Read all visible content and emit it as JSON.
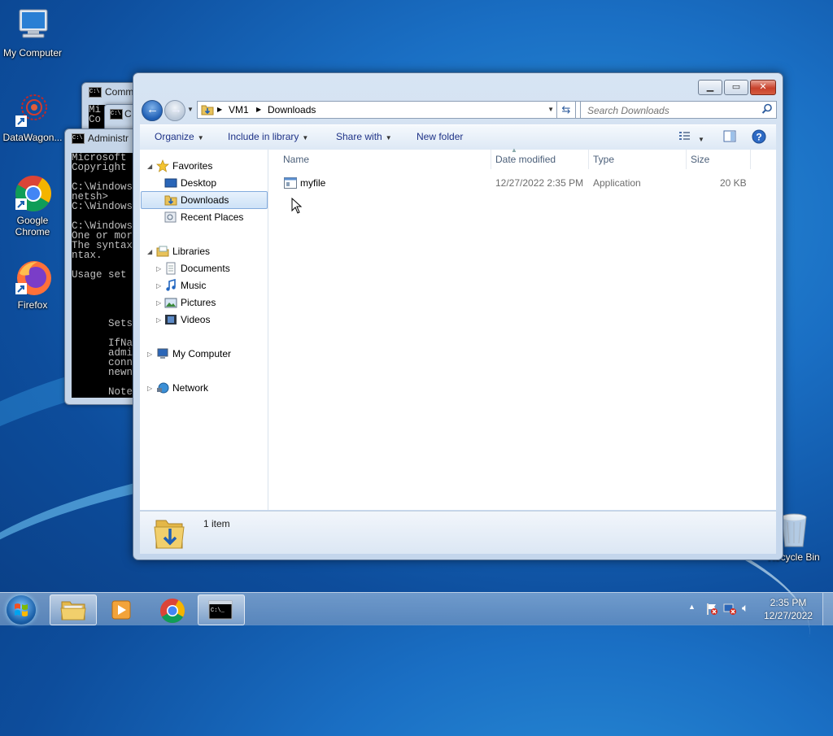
{
  "desktop": {
    "icons": [
      {
        "label": "My Computer",
        "icon": "my-computer-icon"
      },
      {
        "label": "DataWagon...",
        "icon": "datawagon-icon"
      },
      {
        "label": "Google Chrome",
        "icon": "chrome-icon"
      },
      {
        "label": "Firefox",
        "icon": "firefox-icon"
      },
      {
        "label": "Recycle Bin",
        "icon": "recycle-bin-icon"
      }
    ]
  },
  "cmd_windows": [
    {
      "title": "Comm"
    },
    {
      "title": "C"
    },
    {
      "title": "Administr"
    }
  ],
  "cmd_fragments": {
    "small": "Mi\nCo",
    "main": "Microsoft\nCopyright\n\nC:\\Windows\nnetsh>\nC:\\Windows\n\nC:\\Windows\nOne or mor\nThe syntax\nntax.\n\nUsage set\n\n\n\n\n      Sets\n\n      IfNa\n      admi\n      conn\n      newn\n\n      Note"
  },
  "explorer": {
    "address": {
      "crumbs": [
        "VM1",
        "Downloads"
      ]
    },
    "search": {
      "placeholder": "Search Downloads"
    },
    "toolbar": {
      "organize": "Organize",
      "include": "Include in library",
      "share": "Share with",
      "newfolder": "New folder"
    },
    "nav": {
      "favorites": "Favorites",
      "desktop": "Desktop",
      "downloads": "Downloads",
      "recent": "Recent Places",
      "libraries": "Libraries",
      "documents": "Documents",
      "music": "Music",
      "pictures": "Pictures",
      "videos": "Videos",
      "computer": "My Computer",
      "network": "Network"
    },
    "columns": {
      "name": "Name",
      "date": "Date modified",
      "type": "Type",
      "size": "Size"
    },
    "files": [
      {
        "name": "myfile",
        "date": "12/27/2022 2:35 PM",
        "type": "Application",
        "size": "20 KB"
      }
    ],
    "status": {
      "count": "1 item"
    }
  },
  "taskbar": {
    "time": "2:35 PM",
    "date": "12/27/2022",
    "pinned": [
      "explorer-taskbar-icon",
      "media-player-taskbar-icon",
      "chrome-taskbar-icon",
      "cmd-taskbar-icon"
    ]
  },
  "colors": {
    "accent": "#1e3287",
    "selection": "#cde2f7"
  }
}
